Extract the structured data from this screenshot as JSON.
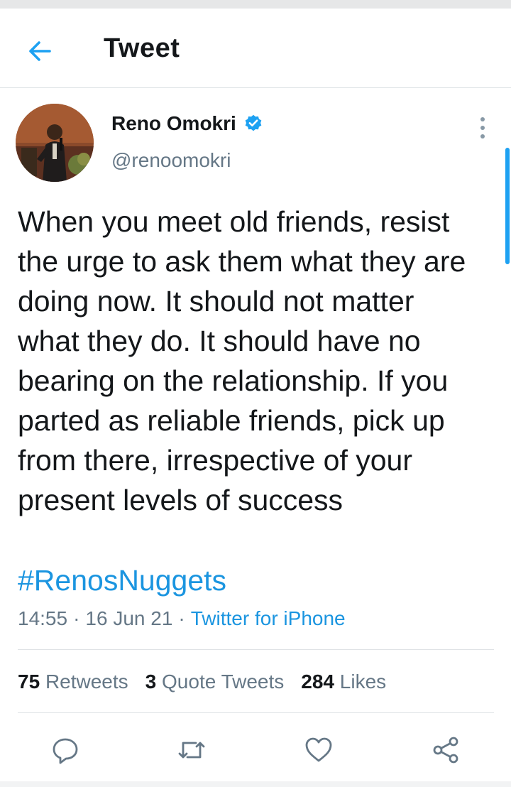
{
  "header": {
    "title": "Tweet",
    "back_icon": "arrow-left-icon"
  },
  "author": {
    "name": "Reno Omokri",
    "handle": "@renoomokri",
    "verified": true
  },
  "tweet": {
    "text": "When you meet old friends, resist\nthe urge to ask them what they are\ndoing now. It should not matter\nwhat they do. It should have no\nbearing on the relationship. If you\nparted as reliable friends, pick up\nfrom there, irrespective of your\npresent levels of success",
    "hashtag": "#RenosNuggets",
    "time": "14:55",
    "date": "16 Jun 21",
    "separator": "·",
    "source": "Twitter for iPhone"
  },
  "stats": {
    "retweets_count": "75",
    "retweets_label": "Retweets",
    "quotes_count": "3",
    "quotes_label": "Quote Tweets",
    "likes_count": "284",
    "likes_label": "Likes"
  },
  "actions": [
    "reply-icon",
    "retweet-icon",
    "like-icon",
    "share-icon"
  ],
  "colors": {
    "accent": "#1da1f2",
    "link": "#1b95e0",
    "secondary_text": "#657786",
    "icon": "#657786",
    "border": "#dfe3e6"
  }
}
